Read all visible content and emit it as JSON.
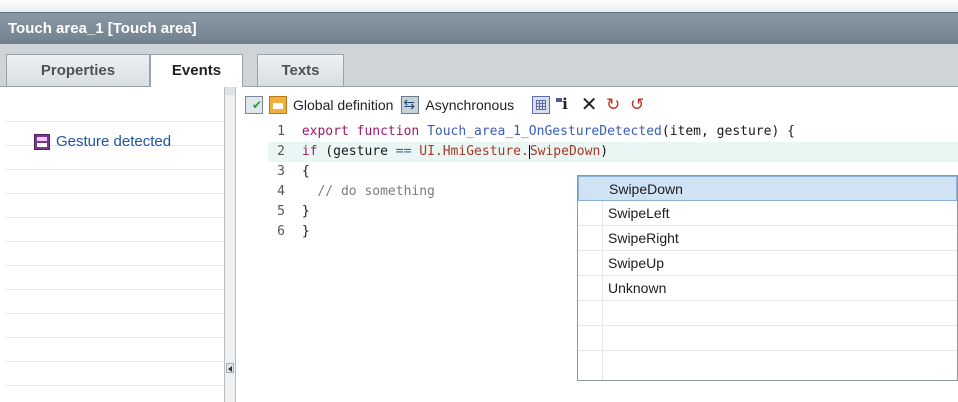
{
  "window": {
    "title": "Touch area_1 [Touch area]"
  },
  "tabs": [
    {
      "label": "Properties"
    },
    {
      "label": "Events"
    },
    {
      "label": "Texts"
    }
  ],
  "events_list": [
    {
      "label": "Gesture detected",
      "icon": "event-io-icon"
    }
  ],
  "toolbar": {
    "global_definition_label": "Global definition",
    "asynchronous_label": "Asynchronous"
  },
  "code": {
    "lines": [
      {
        "num": "1",
        "kw": "export function",
        "name": "Touch_area_1_OnGestureDetected",
        "rest": "(item, gesture) {"
      },
      {
        "num": "2",
        "kw": "if",
        "lhs": " (gesture ",
        "op": "==",
        "ui": "UI.HmiGesture.",
        "member": "SwipeDown",
        "tail": ")"
      },
      {
        "num": "3",
        "text": "{"
      },
      {
        "num": "4",
        "comment": "// do something"
      },
      {
        "num": "5",
        "text": "}"
      },
      {
        "num": "6",
        "text": "}"
      }
    ]
  },
  "autocomplete": {
    "items": [
      "SwipeDown",
      "SwipeLeft",
      "SwipeRight",
      "SwipeUp",
      "Unknown"
    ],
    "selected": "SwipeDown"
  },
  "colors": {
    "titlebar": "#7b8b96",
    "keyword": "#a0186c",
    "function_name": "#3a5db5",
    "ui_namespace": "#a63a2a",
    "selection": "#cfe3f5"
  }
}
